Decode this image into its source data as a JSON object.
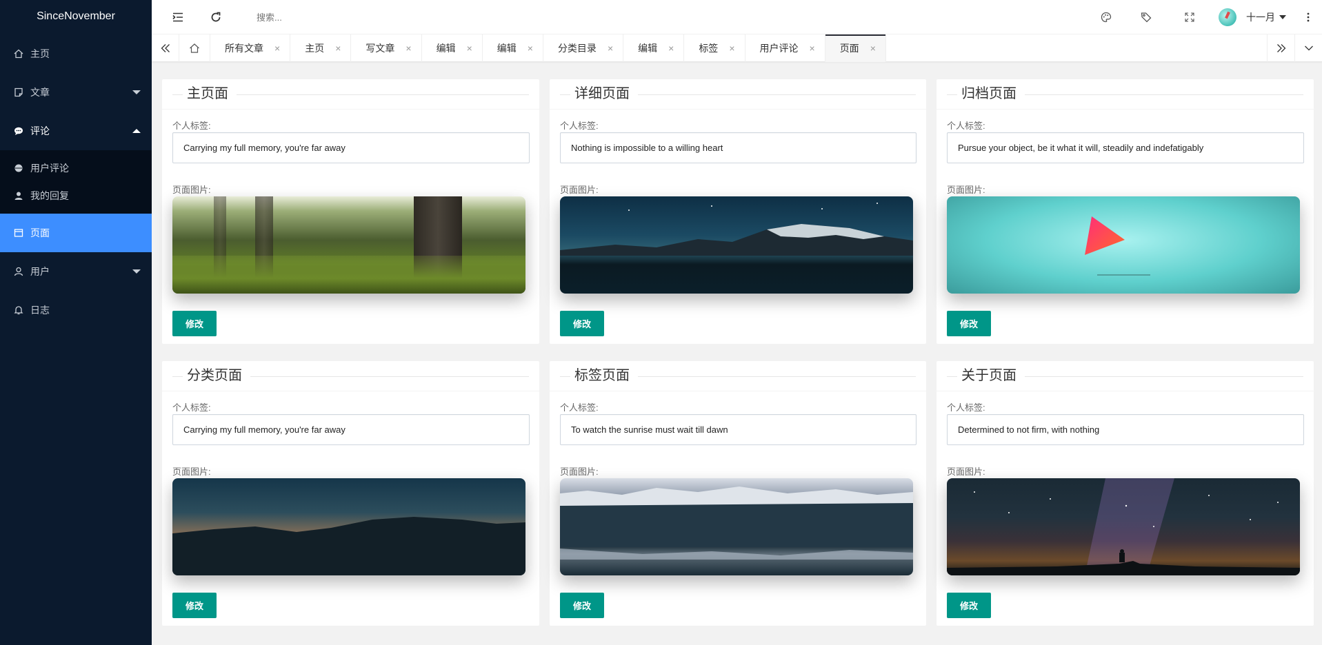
{
  "sidebar": {
    "brand": "SinceNovember",
    "items": [
      {
        "label": "主页",
        "icon": "home-icon"
      },
      {
        "label": "文章",
        "icon": "article-icon"
      },
      {
        "label": "评论",
        "icon": "comment-icon"
      },
      {
        "label": "页面",
        "icon": "page-icon"
      },
      {
        "label": "用户",
        "icon": "user-icon"
      },
      {
        "label": "日志",
        "icon": "bell-icon"
      }
    ],
    "sub_items": [
      {
        "label": "用户评论",
        "icon": "circle-icon"
      },
      {
        "label": "我的回复",
        "icon": "person-icon"
      }
    ]
  },
  "header": {
    "search_placeholder": "搜索...",
    "user_name": "十一月"
  },
  "tabs": [
    "所有文章",
    "主页",
    "写文章",
    "编辑",
    "编辑",
    "分类目录",
    "编辑",
    "标签",
    "用户评论",
    "页面"
  ],
  "tab_close": "×",
  "labels": {
    "tag": "个人标签:",
    "image": "页面图片:",
    "button": "修改"
  },
  "cards": [
    {
      "title": "主页面",
      "tag": "Carrying my full memory, you're far away",
      "image": "forest-path"
    },
    {
      "title": "详细页面",
      "tag": "Nothing is impossible to a willing heart",
      "image": "starry-lake-mountains"
    },
    {
      "title": "归档页面",
      "tag": "Pursue your object, be it what it will, steadily and indefatigably",
      "image": "teal-triangle"
    },
    {
      "title": "分类页面",
      "tag": "Carrying my full memory, you're far away",
      "image": "dusk-silhouette"
    },
    {
      "title": "标签页面",
      "tag": "To watch the sunrise must wait till dawn",
      "image": "snowy-mountain-lake"
    },
    {
      "title": "关于页面",
      "tag": "Determined to not firm, with nothing",
      "image": "milky-way"
    }
  ],
  "colors": {
    "sidebar": "#0b1a2e",
    "active": "#3d8eff",
    "button": "#009688"
  }
}
